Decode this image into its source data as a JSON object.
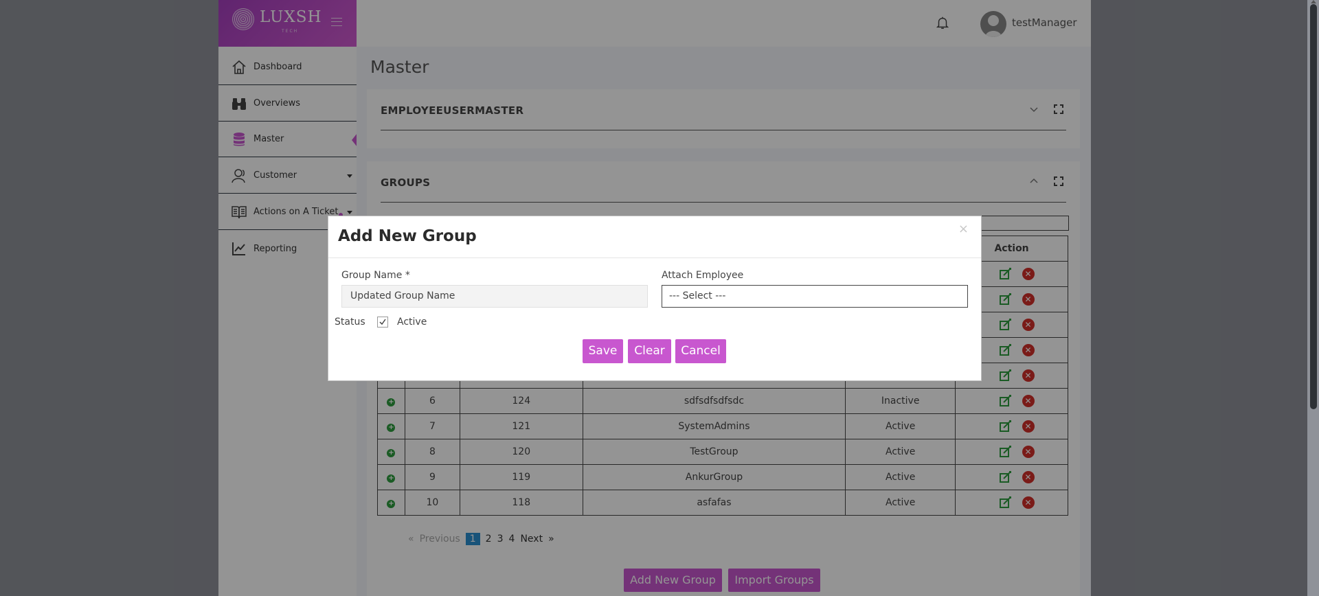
{
  "brand": {
    "logo_text": "LUXSH",
    "logo_sub": "TECH"
  },
  "sidebar": {
    "items": [
      {
        "label": "Dashboard",
        "icon": "home-icon"
      },
      {
        "label": "Overviews",
        "icon": "binoculars-icon"
      },
      {
        "label": "Master",
        "icon": "database-icon",
        "active": true
      },
      {
        "label": "Customer",
        "icon": "users-icon",
        "has_caret": true
      },
      {
        "label": "Actions on A Ticket",
        "icon": "book-icon",
        "has_caret": true
      },
      {
        "label": "Reporting",
        "icon": "line-chart-icon"
      }
    ]
  },
  "header": {
    "username": "testManager"
  },
  "page": {
    "title": "Master"
  },
  "panel_employee": {
    "title": "EMPLOYEEUSERMASTER"
  },
  "panel_groups": {
    "title": "GROUPS",
    "action_header": "Action",
    "rows": [
      {
        "sno": "6",
        "id": "124",
        "name": "sdfsdfsdfsdc",
        "status": "Inactive"
      },
      {
        "sno": "7",
        "id": "121",
        "name": "SystemAdmins",
        "status": "Active"
      },
      {
        "sno": "8",
        "id": "120",
        "name": "TestGroup",
        "status": "Active"
      },
      {
        "sno": "9",
        "id": "119",
        "name": "AnkurGroup",
        "status": "Active"
      },
      {
        "sno": "10",
        "id": "118",
        "name": "asfafas",
        "status": "Active"
      }
    ],
    "pagination": {
      "first": "«",
      "previous": "Previous",
      "pages": [
        "1",
        "2",
        "3",
        "4"
      ],
      "current": "1",
      "next": "Next",
      "last": "»"
    },
    "add_button": "Add New Group",
    "import_button": "Import Groups"
  },
  "modal": {
    "title": "Add New Group",
    "close": "×",
    "group_name_label": "Group Name *",
    "group_name_value": "Updated Group Name",
    "attach_employee_label": "Attach Employee",
    "attach_employee_value": "--- Select ---",
    "status_label": "Status",
    "active_label": "Active",
    "active_checked": true,
    "save_label": "Save",
    "clear_label": "Clear",
    "cancel_label": "Cancel"
  },
  "colors": {
    "accent": "#c857cf",
    "brand_gradient_start": "#a63fbf",
    "pager_current": "#2a8fd1",
    "edit_green": "#2e9e3e",
    "delete_red": "#d3302a"
  }
}
